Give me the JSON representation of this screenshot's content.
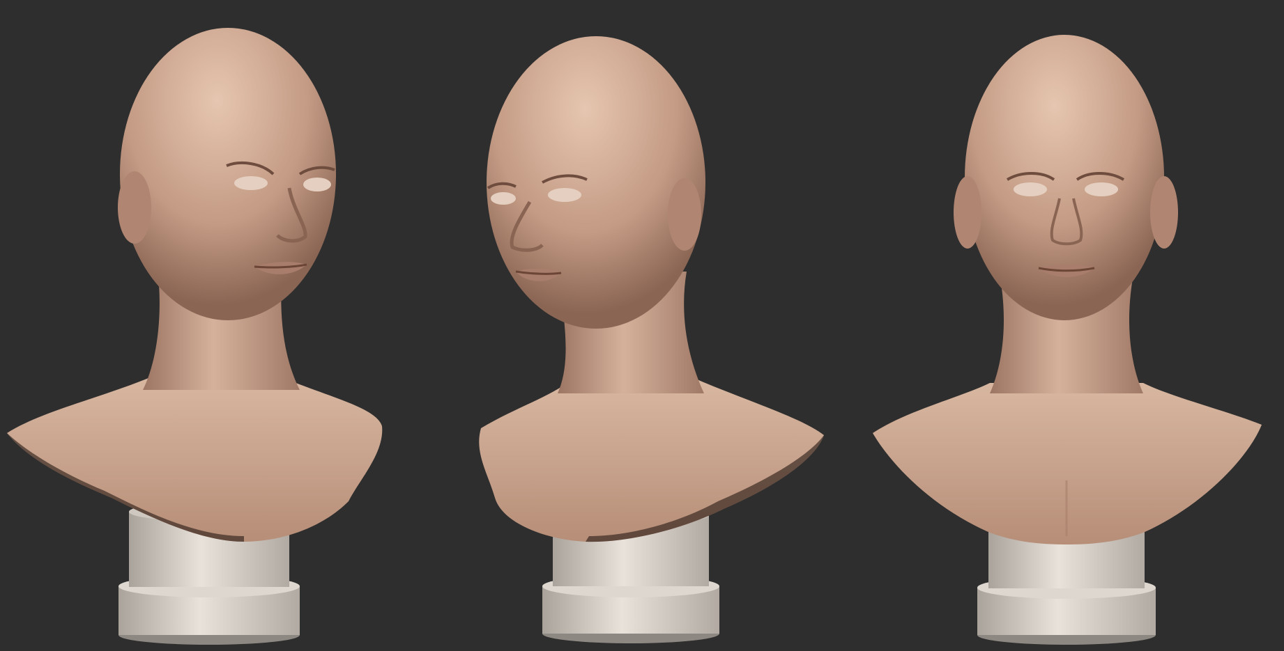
{
  "scene": {
    "background_color": "#2e2e2e",
    "skin_color": "#c9a08a",
    "pedestal_color": "#d9d3cc",
    "busts": [
      {
        "view": "three-quarter-right",
        "label": ""
      },
      {
        "view": "three-quarter-left",
        "label": ""
      },
      {
        "view": "front",
        "label": ""
      }
    ]
  }
}
